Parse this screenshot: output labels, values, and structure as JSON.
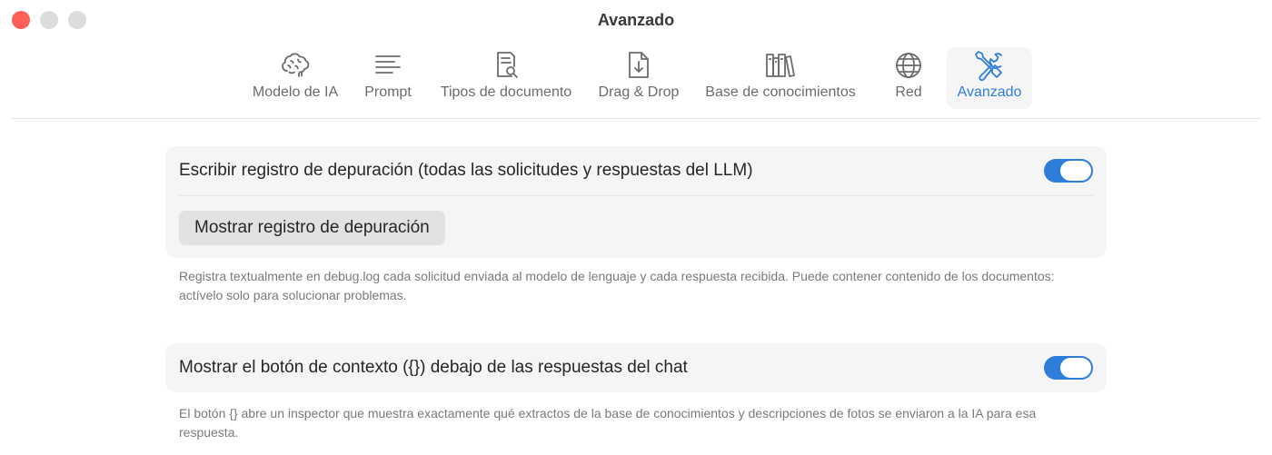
{
  "window": {
    "title": "Avanzado"
  },
  "toolbar": {
    "tabs": [
      {
        "label": "Modelo de IA",
        "icon": "brain-icon",
        "active": false
      },
      {
        "label": "Prompt",
        "icon": "text-lines-icon",
        "active": false
      },
      {
        "label": "Tipos de documento",
        "icon": "document-search-icon",
        "active": false
      },
      {
        "label": "Drag & Drop",
        "icon": "document-download-icon",
        "active": false
      },
      {
        "label": "Base de conocimientos",
        "icon": "books-icon",
        "active": false
      },
      {
        "label": "Red",
        "icon": "globe-icon",
        "active": false
      },
      {
        "label": "Avanzado",
        "icon": "tools-icon",
        "active": true
      }
    ]
  },
  "settings": {
    "debug_log": {
      "label": "Escribir registro de depuración (todas las solicitudes y respuestas del LLM)",
      "enabled": true,
      "button_label": "Mostrar registro de depuración",
      "description": "Registra textualmente en debug.log cada solicitud enviada al modelo de lenguaje y cada respuesta recibida. Puede contener contenido de los documentos: actívelo solo para solucionar problemas."
    },
    "context_button": {
      "label": "Mostrar el botón de contexto ({}) debajo de las respuestas del chat",
      "enabled": true,
      "description": "El botón {} abre un inspector que muestra exactamente qué extractos de la base de conocimientos y descripciones de fotos se enviaron a la IA para esa respuesta."
    }
  },
  "colors": {
    "accent": "#2f7ddb",
    "close": "#fe5f57",
    "inactive_light": "#dcdcdc"
  }
}
